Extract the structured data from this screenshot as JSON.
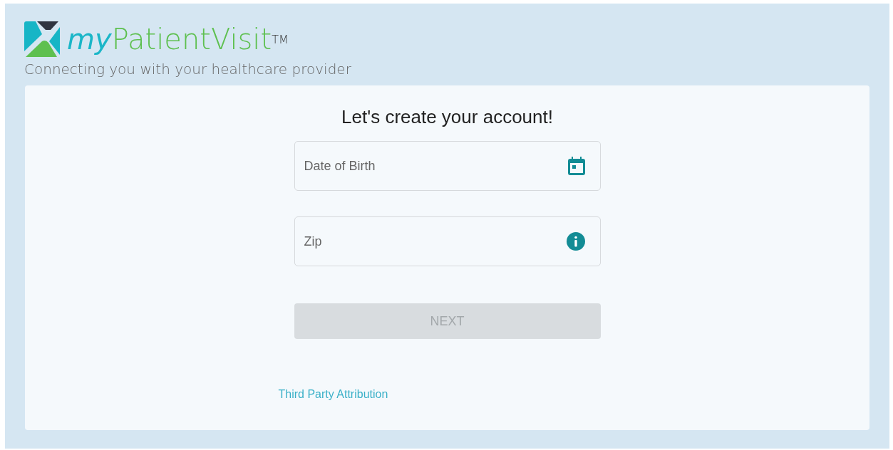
{
  "header": {
    "logo": {
      "prefix": "my",
      "name": "PatientVisit",
      "mark": "TM"
    },
    "tagline": "Connecting you with your healthcare provider"
  },
  "form": {
    "title": "Let's create your account!",
    "fields": [
      {
        "placeholder": "Date of Birth",
        "kind": "date"
      },
      {
        "placeholder": "Zip",
        "kind": "info"
      }
    ],
    "button": {
      "label": "NEXT",
      "disabled": true
    },
    "link": "Third Party Attribution"
  }
}
